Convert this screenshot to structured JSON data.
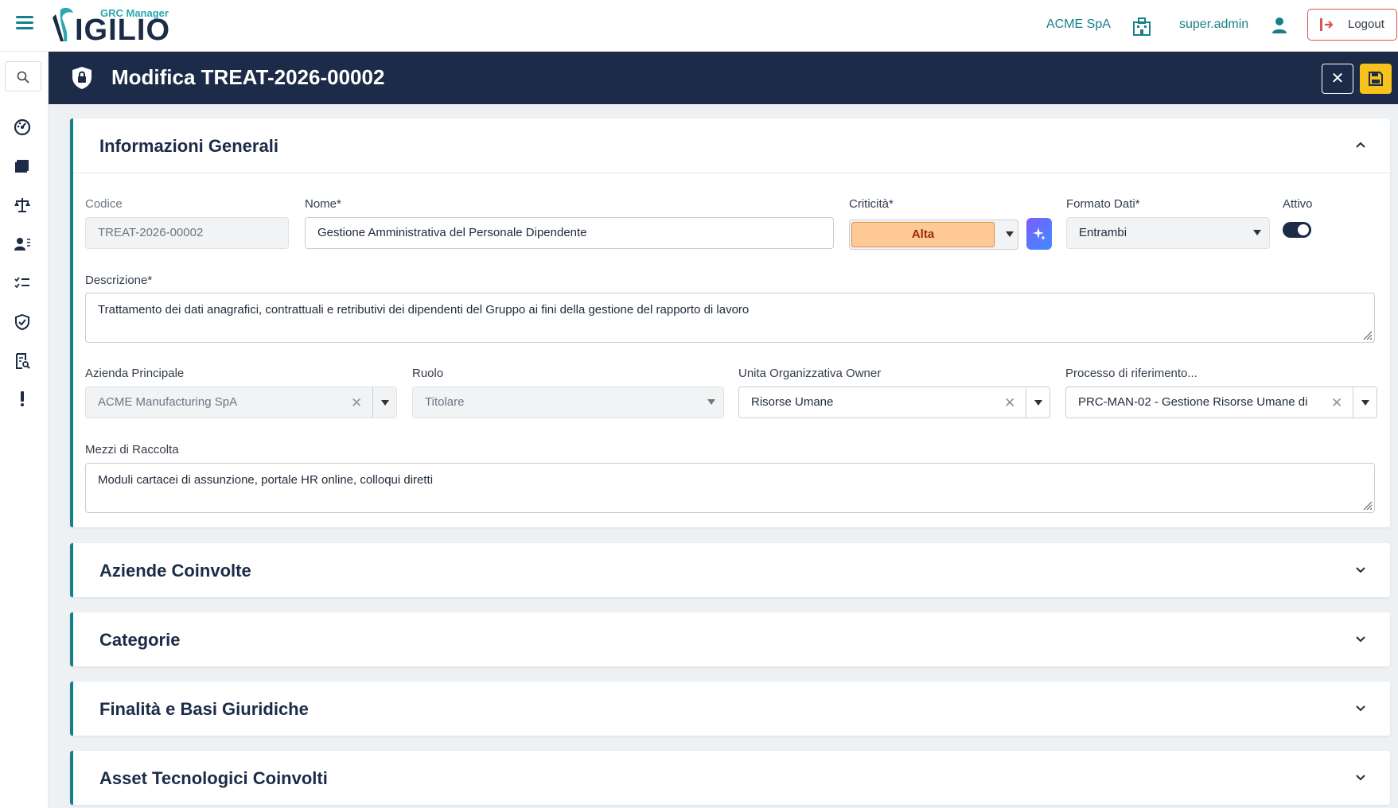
{
  "app": {
    "logo_sub": "GRC Manager",
    "logo_main": "IGILIO"
  },
  "header": {
    "company": "ACME SpA",
    "user": "super.admin",
    "logout_label": "Logout"
  },
  "sidebar": {
    "items": [
      {
        "icon": "dashboard-icon"
      },
      {
        "icon": "registry-icon"
      },
      {
        "icon": "balance-scale-icon"
      },
      {
        "icon": "user-list-icon"
      },
      {
        "icon": "checklist-icon"
      },
      {
        "icon": "shield-icon"
      },
      {
        "icon": "document-search-icon"
      },
      {
        "icon": "exclamation-icon"
      }
    ]
  },
  "title_bar": {
    "title": "Modifica TREAT-2026-00002"
  },
  "general": {
    "title": "Informazioni Generali",
    "codice": {
      "label": "Codice",
      "value": "TREAT-2026-00002"
    },
    "nome": {
      "label": "Nome*",
      "value": "Gestione Amministrativa del Personale Dipendente"
    },
    "criticita": {
      "label": "Criticità*",
      "value": "Alta"
    },
    "formato": {
      "label": "Formato Dati*",
      "value": "Entrambi"
    },
    "attivo": {
      "label": "Attivo",
      "value": true
    },
    "descrizione": {
      "label": "Descrizione*",
      "value": "Trattamento dei dati anagrafici, contrattuali e retributivi dei dipendenti del Gruppo ai fini della gestione del rapporto di lavoro"
    },
    "azienda": {
      "label": "Azienda Principale",
      "value": "ACME Manufacturing SpA"
    },
    "ruolo": {
      "label": "Ruolo",
      "value": "Titolare"
    },
    "unita": {
      "label": "Unita Organizzativa Owner",
      "value": "Risorse Umane"
    },
    "processo": {
      "label": "Processo di riferimento...",
      "value": "PRC-MAN-02  - Gestione Risorse Umane di"
    },
    "mezzi": {
      "label": "Mezzi di Raccolta",
      "value": "Moduli cartacei di assunzione, portale HR online, colloqui diretti"
    }
  },
  "sections": [
    {
      "title": "Aziende Coinvolte"
    },
    {
      "title": "Categorie"
    },
    {
      "title": "Finalità e Basi Giuridiche"
    },
    {
      "title": "Asset Tecnologici Coinvolti"
    }
  ],
  "colors": {
    "navy": "#1b2b48",
    "teal": "#16808a",
    "save_yellow": "#f7c21b",
    "critical_bg": "#ffc996",
    "danger": "#d9534f"
  }
}
